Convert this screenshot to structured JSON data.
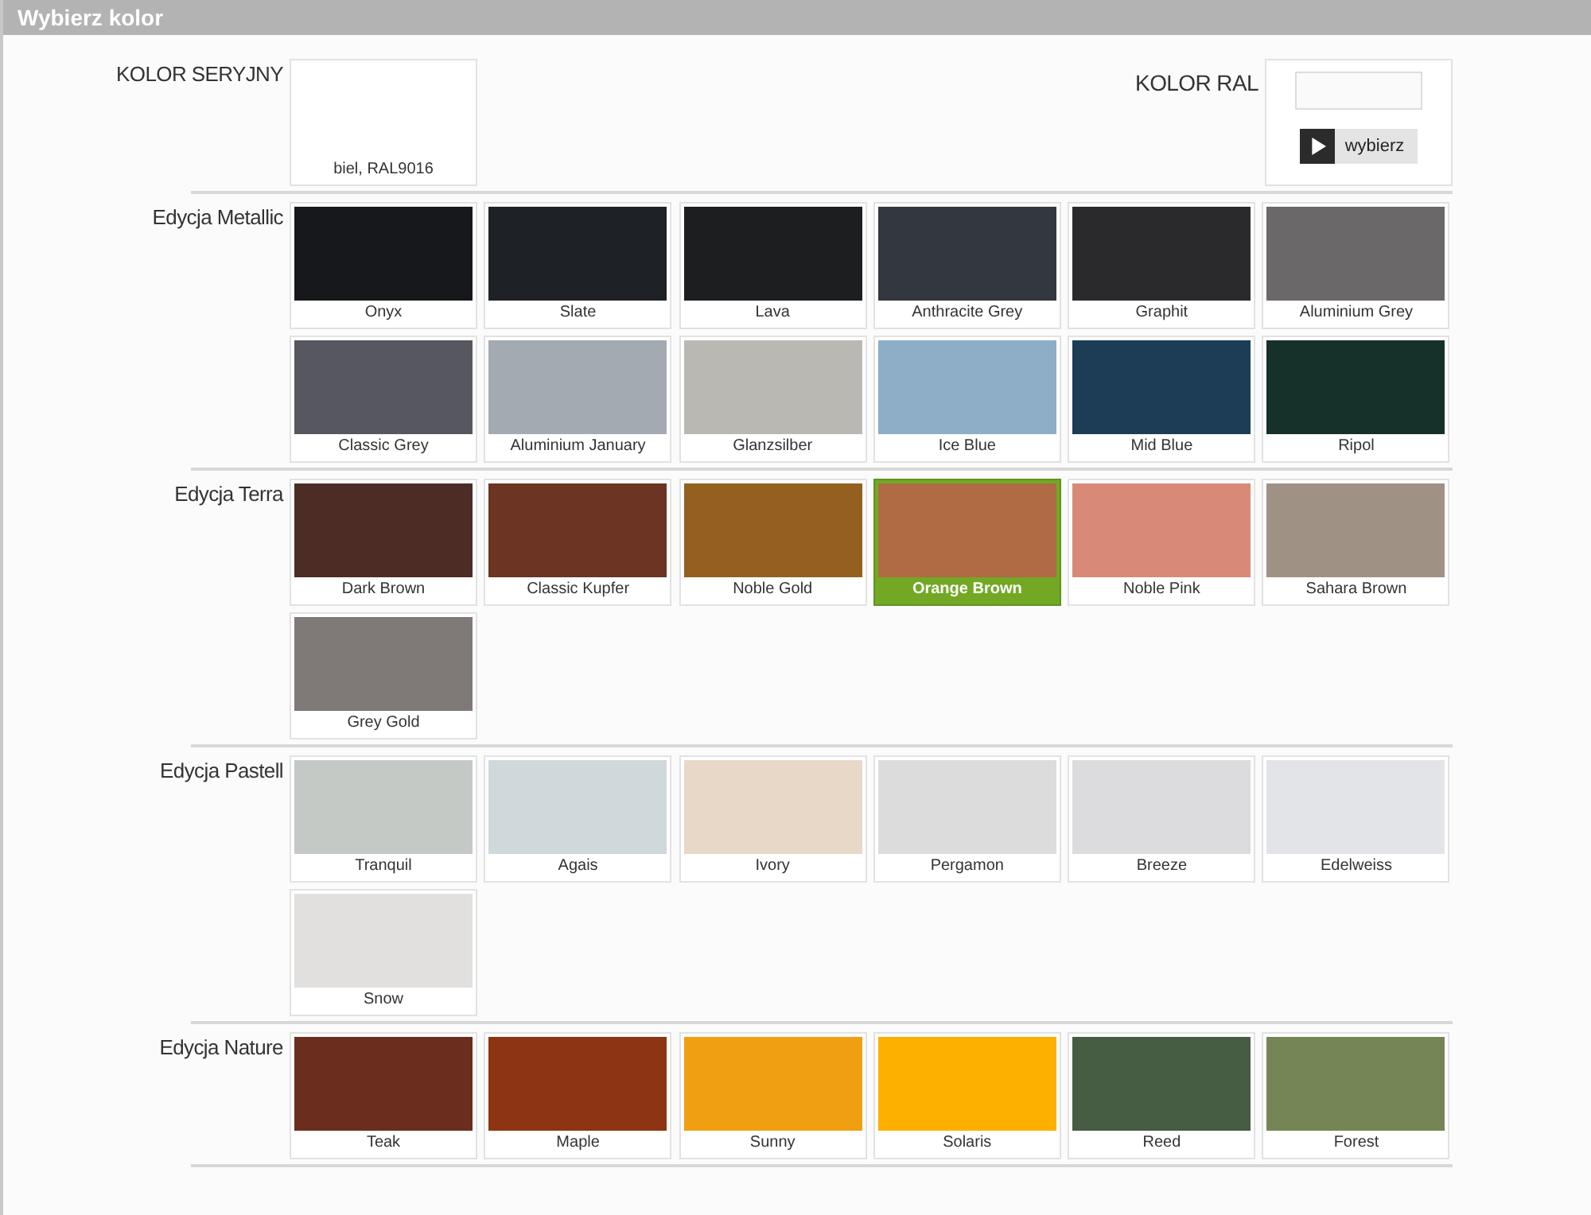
{
  "window": {
    "title": "Wybierz kolor"
  },
  "standard": {
    "label": "KOLOR SERYJNY",
    "swatch": {
      "name": "biel, RAL9016",
      "selected": false
    }
  },
  "ral": {
    "label": "KOLOR RAL",
    "button": "wybierz"
  },
  "sections": [
    {
      "title": "Edycja Metallic",
      "swatches": [
        {
          "name": "Onyx",
          "color": "#16181c",
          "selected": false
        },
        {
          "name": "Slate",
          "color": "#1e2126",
          "selected": false
        },
        {
          "name": "Lava",
          "color": "#1d1e20",
          "selected": false
        },
        {
          "name": "Anthracite Grey",
          "color": "#33383e",
          "selected": false
        },
        {
          "name": "Graphit",
          "color": "#2a292b",
          "selected": false
        },
        {
          "name": "Aluminium Grey",
          "color": "#6a6869",
          "selected": false
        },
        {
          "name": "Classic Grey",
          "color": "#56575f",
          "selected": false
        },
        {
          "name": "Aluminium January",
          "color": "#a4aab2",
          "selected": false
        },
        {
          "name": "Glanzsilber",
          "color": "#b9b8b3",
          "selected": false
        },
        {
          "name": "Ice Blue",
          "color": "#8eadc6",
          "selected": false
        },
        {
          "name": "Mid Blue",
          "color": "#1c3d55",
          "selected": false
        },
        {
          "name": "Ripol",
          "color": "#16302a",
          "selected": false
        }
      ]
    },
    {
      "title": "Edycja Terra",
      "swatches": [
        {
          "name": "Dark Brown",
          "color": "#4d2c26",
          "selected": false
        },
        {
          "name": "Classic Kupfer",
          "color": "#6b3423",
          "selected": false
        },
        {
          "name": "Noble Gold",
          "color": "#94601f",
          "selected": false
        },
        {
          "name": "Orange Brown",
          "color": "#b06a44",
          "selected": true
        },
        {
          "name": "Noble Pink",
          "color": "#d98a76",
          "selected": false
        },
        {
          "name": "Sahara Brown",
          "color": "#a09185",
          "selected": false
        },
        {
          "name": "Grey Gold",
          "color": "#7f7a77",
          "selected": false
        }
      ]
    },
    {
      "title": "Edycja Pastell",
      "swatches": [
        {
          "name": "Tranquil",
          "color": "#c4c9c6",
          "selected": false
        },
        {
          "name": "Agais",
          "color": "#cfd8da",
          "selected": false
        },
        {
          "name": "Ivory",
          "color": "#e8d8c8",
          "selected": false
        },
        {
          "name": "Pergamon",
          "color": "#dcdcdd",
          "selected": false
        },
        {
          "name": "Breeze",
          "color": "#dcdcde",
          "selected": false
        },
        {
          "name": "Edelweiss",
          "color": "#e3e4e7",
          "selected": false
        },
        {
          "name": "Snow",
          "color": "#e2e0df",
          "selected": false
        }
      ]
    },
    {
      "title": "Edycja Nature",
      "swatches": [
        {
          "name": "Teak",
          "color": "#6b2e1e",
          "selected": false
        },
        {
          "name": "Maple",
          "color": "#8d3412",
          "selected": false
        },
        {
          "name": "Sunny",
          "color": "#f09f13",
          "selected": false
        },
        {
          "name": "Solaris",
          "color": "#fdb000",
          "selected": false
        },
        {
          "name": "Reed",
          "color": "#465c43",
          "selected": false
        },
        {
          "name": "Forest",
          "color": "#768556",
          "selected": false
        }
      ]
    }
  ]
}
